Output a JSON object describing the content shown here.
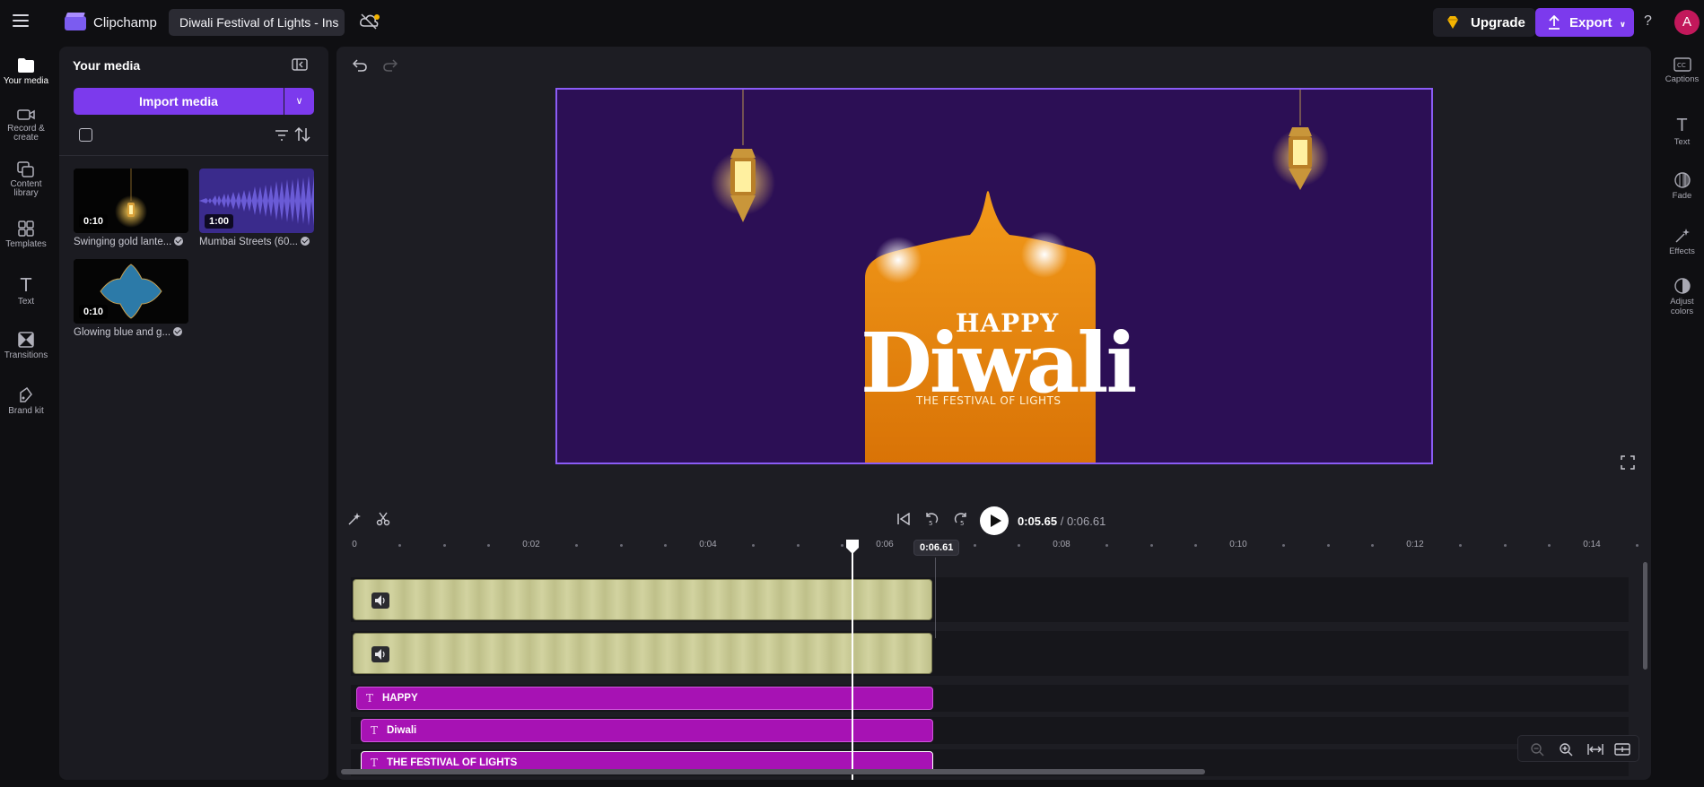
{
  "app": {
    "brand": "Clipchamp",
    "project_title": "Diwali Festival of Lights - Ins",
    "upgrade_label": "Upgrade",
    "export_label": "Export",
    "help_label": "?",
    "avatar_initial": "A",
    "accent_color": "#7c3aed"
  },
  "left_nav": [
    {
      "label": "Your media",
      "icon": "folder-icon",
      "active": true
    },
    {
      "label": "Record &\ncreate",
      "icon": "camera-icon"
    },
    {
      "label": "Content\nlibrary",
      "icon": "library-icon"
    },
    {
      "label": "Templates",
      "icon": "templates-icon"
    },
    {
      "label": "Text",
      "icon": "text-icon"
    },
    {
      "label": "Transitions",
      "icon": "transitions-icon"
    },
    {
      "label": "Brand kit",
      "icon": "brand-kit-icon"
    }
  ],
  "media_panel": {
    "title": "Your media",
    "import_label": "Import media",
    "items": [
      {
        "name": "Swinging gold lante...",
        "duration": "0:10"
      },
      {
        "name": "Mumbai Streets (60...",
        "duration": "1:00"
      },
      {
        "name": "Glowing blue and g...",
        "duration": "0:10"
      }
    ]
  },
  "preview": {
    "headline_small": "HAPPY",
    "headline_big": "Diwali",
    "tagline": "THE FESTIVAL OF LIGHTS",
    "bg_color": "#2c0f55",
    "shape_color": "#e07a07"
  },
  "player": {
    "current_time": "0:05.65",
    "total_time": "/ 0:06.61"
  },
  "timeline": {
    "ruler_labels": [
      "0",
      "0:02",
      "0:04",
      "0:06",
      "0:08",
      "0:10",
      "0:12",
      "0:14"
    ],
    "playhead_label": "0:06.61",
    "text_clips": [
      "HAPPY",
      "Diwali",
      "THE FESTIVAL OF LIGHTS"
    ]
  },
  "right_nav": [
    {
      "label": "Captions",
      "icon": "captions-icon"
    },
    {
      "label": "Text",
      "icon": "text-icon"
    },
    {
      "label": "Fade",
      "icon": "fade-icon"
    },
    {
      "label": "Effects",
      "icon": "effects-icon"
    },
    {
      "label": "Adjust\ncolors",
      "icon": "adjust-colors-icon"
    }
  ]
}
